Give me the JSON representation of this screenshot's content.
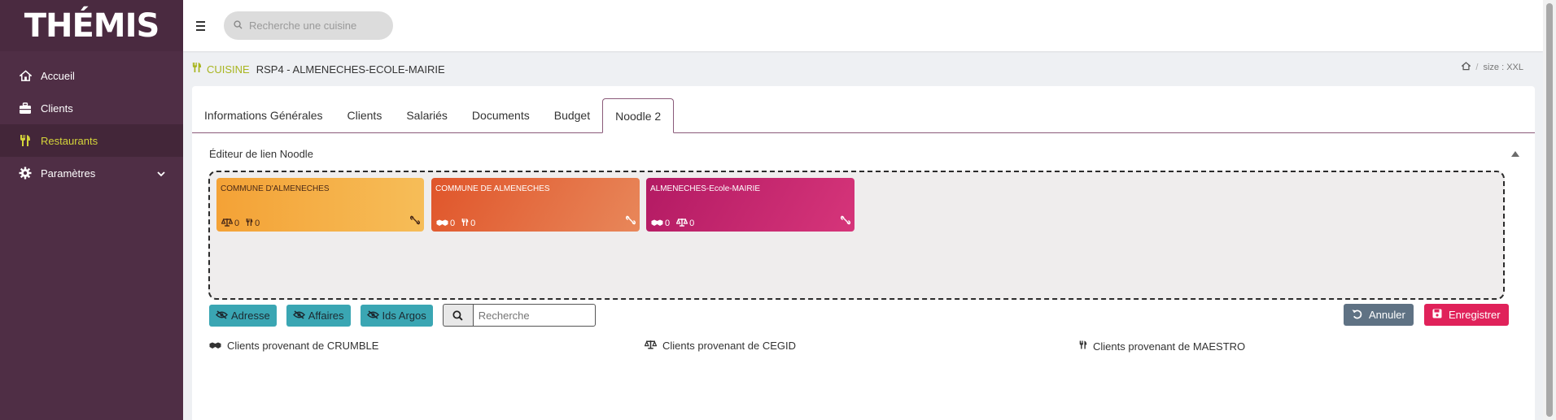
{
  "app": {
    "logo_text": "THÉMIS"
  },
  "sidebar": {
    "items": [
      {
        "label": "Accueil",
        "icon": "home-icon"
      },
      {
        "label": "Clients",
        "icon": "briefcase-icon"
      },
      {
        "label": "Restaurants",
        "icon": "cutlery-icon",
        "active": true
      },
      {
        "label": "Paramètres",
        "icon": "gear-icon",
        "has_children": true
      }
    ]
  },
  "topbar": {
    "search_placeholder": "Recherche une cuisine"
  },
  "header": {
    "section_label": "CUISINE",
    "name": "RSP4 - ALMENECHES-ECOLE-MAIRIE",
    "breadcrumb_size": "size : XXL"
  },
  "tabs": [
    {
      "label": "Informations Générales"
    },
    {
      "label": "Clients"
    },
    {
      "label": "Salariés"
    },
    {
      "label": "Documents"
    },
    {
      "label": "Budget"
    },
    {
      "label": "Noodle 2",
      "active": true
    }
  ],
  "editor": {
    "title": "Éditeur de lien Noodle",
    "nodes": [
      {
        "title": "COMMUNE D'ALMENECHES",
        "stat1_icon": "scale-icon",
        "stat1": "0",
        "stat2_icon": "cutlery-icon",
        "stat2": "0"
      },
      {
        "title": "COMMUNE DE ALMENECHES",
        "stat1_icon": "handshake-icon",
        "stat1": "0",
        "stat2_icon": "cutlery-icon",
        "stat2": "0"
      },
      {
        "title": "ALMENECHES-Ecole-MAIRIE",
        "stat1_icon": "handshake-icon",
        "stat1": "0",
        "stat2_icon": "scale-icon",
        "stat2": "0"
      }
    ]
  },
  "filters": {
    "address": "Adresse",
    "affairs": "Affaires",
    "argos": "Ids Argos",
    "search_placeholder": "Recherche"
  },
  "actions": {
    "cancel": "Annuler",
    "save": "Enregistrer"
  },
  "legend": {
    "crumble": "Clients provenant de CRUMBLE",
    "cegid": "Clients provenant de CEGID",
    "maestro": "Clients provenant de MAESTRO"
  },
  "colors": {
    "sidebar": "#4f2e45",
    "accent_yellow": "#a8b51f",
    "teal": "#3aa6b3",
    "save_red": "#e0225a",
    "cancel_slate": "#5f7284"
  }
}
